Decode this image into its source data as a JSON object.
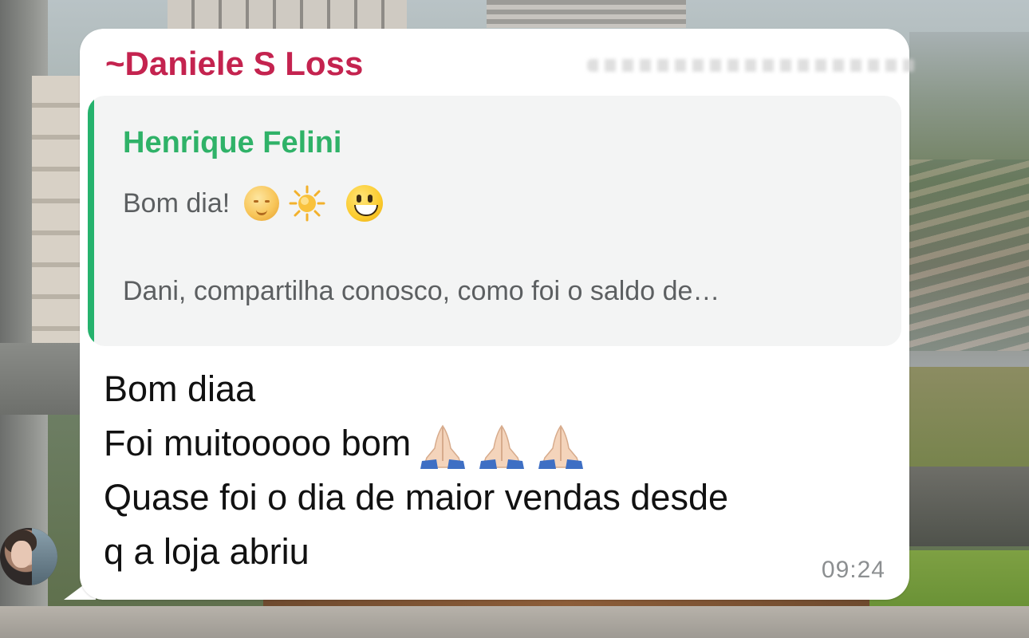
{
  "message": {
    "sender_name": "~Daniele S Loss",
    "quoted": {
      "author": "Henrique Felini",
      "line1_text": "Bom dia!",
      "line1_emojis": [
        "sun-with-face-icon",
        "sun-icon",
        "smiley-face-icon"
      ],
      "line2_text": "Dani, compartilha conosco, como foi o saldo de…"
    },
    "body_lines": [
      "Bom diaa",
      "Foi muitooooo bom",
      "Quase foi o dia de maior vendas desde",
      "q a loja abriu"
    ],
    "body_line2_emojis": [
      "folded-hands-icon",
      "folded-hands-icon",
      "folded-hands-icon"
    ],
    "timestamp": "09:24"
  },
  "colors": {
    "sender_name": "#c4234f",
    "quoted_author": "#2fb268",
    "quote_bar": "#25b26d",
    "quote_background": "#f3f4f4",
    "bubble_background": "#ffffff",
    "timestamp": "#8c8f91"
  }
}
